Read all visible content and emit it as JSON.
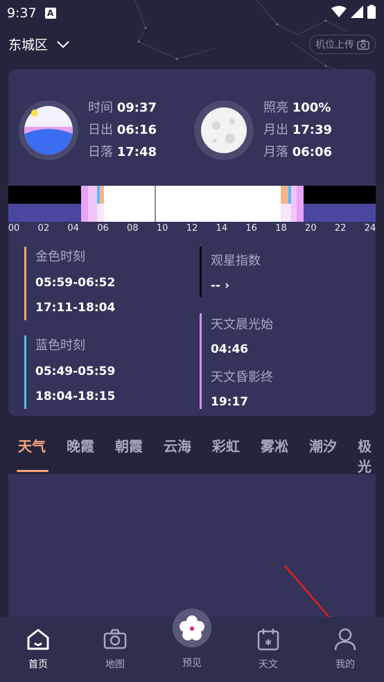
{
  "status_bar": {
    "time": "9:37",
    "badge": "A"
  },
  "header": {
    "location": "东城区",
    "upload_label": "机位上传"
  },
  "sun": {
    "time_label": "时间",
    "time_value": "09:37",
    "rise_label": "日出",
    "rise_value": "06:16",
    "set_label": "日落",
    "set_value": "17:48"
  },
  "moon": {
    "illum_label": "照亮",
    "illum_value": "100%",
    "rise_label": "月出",
    "rise_value": "17:39",
    "set_label": "月落",
    "set_value": "06:06"
  },
  "timeline_ticks": [
    "00",
    "02",
    "04",
    "06",
    "08",
    "10",
    "12",
    "14",
    "16",
    "18",
    "20",
    "22",
    "24"
  ],
  "golden_hour": {
    "title": "金色时刻",
    "morning": "05:59-06:52",
    "evening": "17:11-18:04"
  },
  "blue_hour": {
    "title": "蓝色时刻",
    "morning": "05:49-05:59",
    "evening": "18:04-18:15"
  },
  "stargazing": {
    "title": "观星指数",
    "value": "-- ›"
  },
  "astro_dawn": {
    "title": "天文晨光始",
    "value": "04:46"
  },
  "astro_dusk": {
    "title": "天文昏影终",
    "value": "19:17"
  },
  "tabs": [
    "天气",
    "晚霞",
    "朝霞",
    "云海",
    "彩虹",
    "雾凇",
    "潮汐",
    "极光"
  ],
  "active_tab": "天气",
  "bottom_nav": {
    "home": "首页",
    "map": "地图",
    "preview": "预见",
    "astronomy": "天文",
    "profile": "我的"
  },
  "colors": {
    "background": "#25243d",
    "card": "#34335a",
    "accent": "#f4a27d",
    "golden": "#f4a27d",
    "blue": "#5bb8f5",
    "violet": "#d98cf0"
  }
}
